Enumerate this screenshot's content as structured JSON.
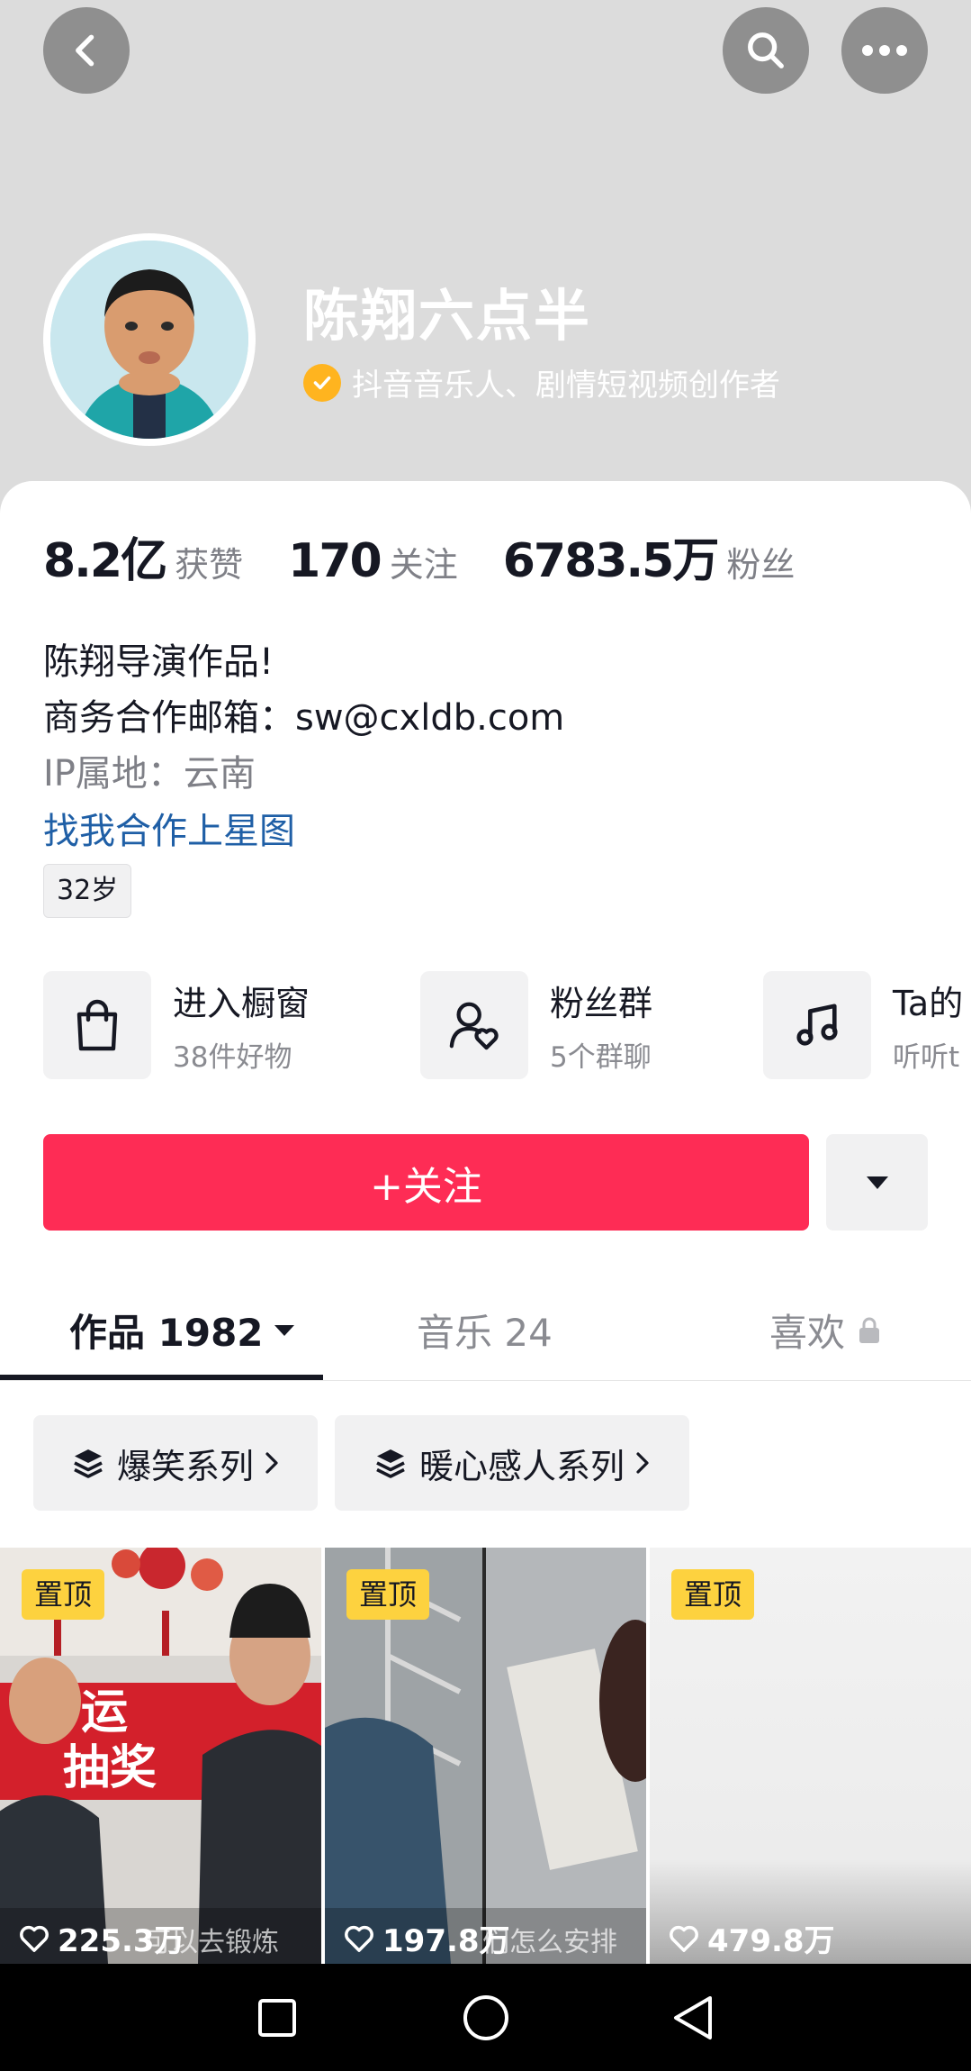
{
  "profile": {
    "name": "陈翔六点半",
    "verification": "抖音音乐人、剧情短视频创作者"
  },
  "stats": [
    {
      "value": "8.2亿",
      "label": "获赞"
    },
    {
      "value": "170",
      "label": "关注"
    },
    {
      "value": "6783.5万",
      "label": "粉丝"
    }
  ],
  "bio": {
    "line1": "陈翔导演作品!",
    "line2": "商务合作邮箱：sw@cxldb.com",
    "ip": "IP属地：云南",
    "link": "找我合作上星图",
    "age": "32岁"
  },
  "entries": [
    {
      "title": "进入橱窗",
      "sub": "38件好物",
      "icon": "shopping-bag-icon"
    },
    {
      "title": "粉丝群",
      "sub": "5个群聊",
      "icon": "user-heart-icon"
    },
    {
      "title": "Ta的",
      "sub": "听听t",
      "icon": "music-note-icon"
    }
  ],
  "actions": {
    "follow_label": "+关注"
  },
  "tabs": [
    {
      "label": "作品 1982"
    },
    {
      "label": "音乐 24"
    },
    {
      "label": "喜欢"
    }
  ],
  "collections": [
    {
      "label": "爆笑系列"
    },
    {
      "label": "暖心感人系列"
    }
  ],
  "videos": [
    {
      "badge": "置顶",
      "likes": "225.3万",
      "caption": "可以去锻炼"
    },
    {
      "badge": "置顶",
      "likes": "197.8万",
      "caption": "们怎么安排"
    },
    {
      "badge": "置顶",
      "likes": "479.8万",
      "caption": ""
    }
  ],
  "video_art": {
    "banner_line1": "运",
    "banner_line2": "抽奖"
  },
  "colors": {
    "accent": "#fe2c55",
    "link": "#1f5fa6",
    "verify": "#ffb41f",
    "pin": "#fdd23f"
  }
}
